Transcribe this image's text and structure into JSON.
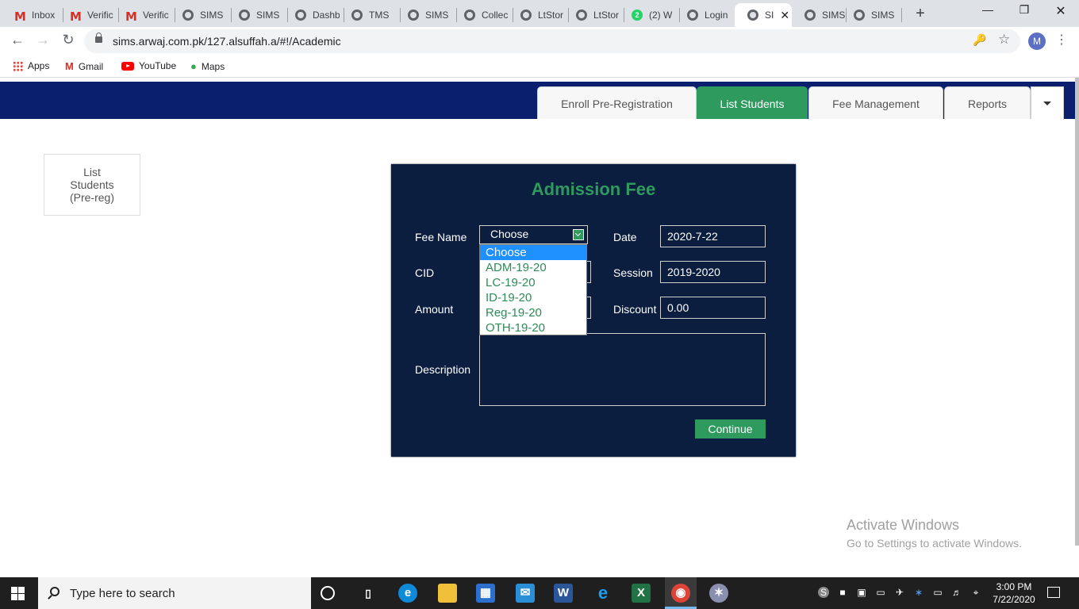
{
  "browser": {
    "tabs": [
      {
        "label": "Inbox",
        "icon": "gmail-icon"
      },
      {
        "label": "Verific",
        "icon": "gmail-icon"
      },
      {
        "label": "Verific",
        "icon": "gmail-icon"
      },
      {
        "label": "SIMS",
        "icon": "globe-icon"
      },
      {
        "label": "SIMS",
        "icon": "globe-icon"
      },
      {
        "label": "Dashb",
        "icon": "globe-icon"
      },
      {
        "label": "TMS",
        "icon": "globe-icon"
      },
      {
        "label": "SIMS",
        "icon": "globe-icon"
      },
      {
        "label": "Collec",
        "icon": "globe-icon"
      },
      {
        "label": "LtStor",
        "icon": "globe-icon"
      },
      {
        "label": "LtStor",
        "icon": "globe-icon"
      },
      {
        "label": "(2) W",
        "icon": "whatsapp-icon",
        "badge": "2"
      },
      {
        "label": "Login",
        "icon": "globe-icon"
      },
      {
        "label": "SI",
        "icon": "globe-icon",
        "active": true
      },
      {
        "label": "SIMS",
        "icon": "globe-icon"
      },
      {
        "label": "SIMS",
        "icon": "globe-icon"
      }
    ],
    "new_tab": "+",
    "close_glyph": "✕",
    "url": "sims.arwaj.com.pk/127.alsuffah.a/#!/Academic",
    "avatar_letter": "M",
    "bookmarks": [
      {
        "label": "Apps",
        "icon": "apps-icon"
      },
      {
        "label": "Gmail",
        "icon": "gmail-icon"
      },
      {
        "label": "YouTube",
        "icon": "youtube-icon"
      },
      {
        "label": "Maps",
        "icon": "maps-icon"
      }
    ]
  },
  "app": {
    "nav_tabs": [
      {
        "label": "Enroll Pre-Registration",
        "active": false
      },
      {
        "label": "List Students",
        "active": true
      },
      {
        "label": "Fee Management",
        "active": false
      },
      {
        "label": "Reports",
        "active": false
      }
    ],
    "side_card": "List Students (Pre-reg)",
    "form": {
      "title": "Admission Fee",
      "fee_name_label": "Fee Name",
      "fee_name_value": "Choose",
      "fee_options": [
        "Choose",
        "ADM-19-20",
        "LC-19-20",
        "ID-19-20",
        "Reg-19-20",
        "OTH-19-20"
      ],
      "cid_label": "CID",
      "amount_label": "Amount",
      "description_label": "Description",
      "date_label": "Date",
      "date_value": "2020-7-22",
      "session_label": "Session",
      "session_value": "2019-2020",
      "discount_label": "Discount",
      "discount_value": "0.00",
      "continue_label": "Continue"
    }
  },
  "watermark": {
    "title": "Activate Windows",
    "subtitle": "Go to Settings to activate Windows."
  },
  "taskbar": {
    "search_placeholder": "Type here to search",
    "time": "3:00 PM",
    "date": "7/22/2020"
  },
  "colors": {
    "header_blue": "#0a1f6e",
    "panel_navy": "#0b1e3f",
    "accent_green": "#2e9a5e"
  }
}
